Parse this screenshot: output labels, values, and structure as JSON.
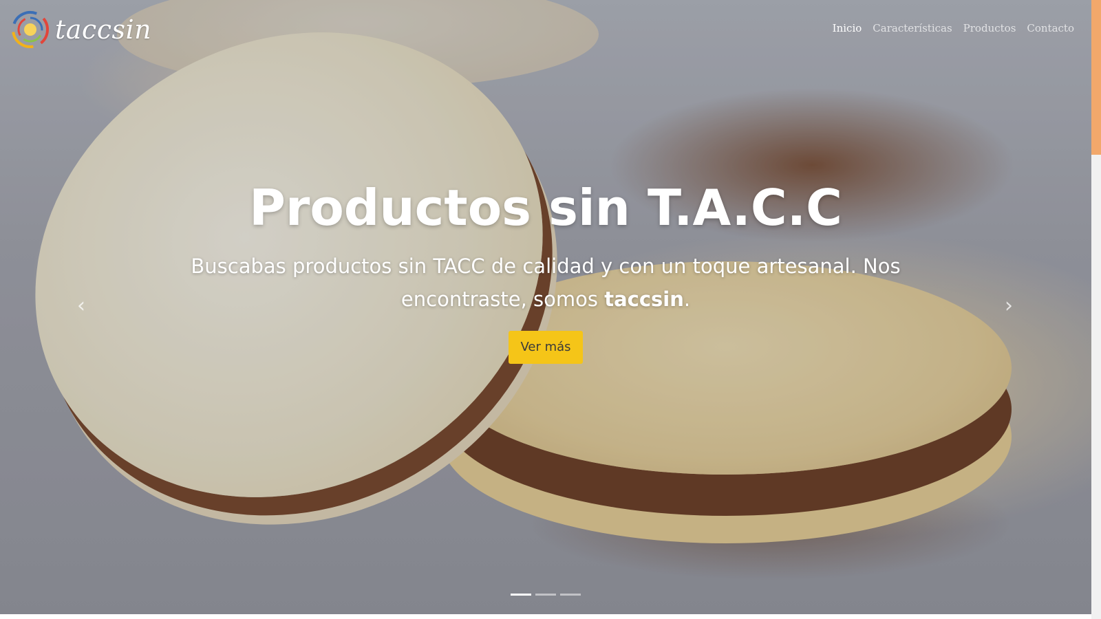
{
  "navbar": {
    "brand_name": "taccsin",
    "logo_icon": "spiral-logo-icon",
    "links": [
      {
        "label": "Inicio",
        "active": true
      },
      {
        "label": "Características",
        "active": false
      },
      {
        "label": "Productos",
        "active": false
      },
      {
        "label": "Contacto",
        "active": false
      }
    ]
  },
  "hero": {
    "title": "Productos sin T.A.C.C",
    "text_before": "Buscabas productos sin TACC de calidad y con un toque artesanal. Nos encontraste, somos ",
    "text_brand": "taccsin",
    "text_after": ".",
    "button_label": "Ver más",
    "prev_icon": "chevron-left-icon",
    "next_icon": "chevron-right-icon",
    "prev_glyph": "‹",
    "next_glyph": "›",
    "slides_count": 3,
    "active_slide": 1
  },
  "colors": {
    "accent_button": "#f5c518",
    "scroll_thumb": "#f2a86b"
  }
}
